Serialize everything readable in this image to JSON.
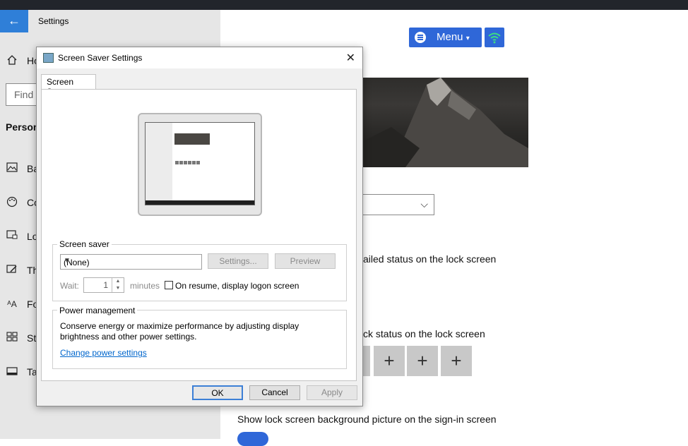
{
  "settings": {
    "title": "Settings",
    "back_icon": "←",
    "search_placeholder": "Find",
    "section_label": "Person",
    "nav_items": [
      {
        "label": "Ho",
        "icon": "home-icon"
      },
      {
        "label": "Ba",
        "icon": "picture-icon"
      },
      {
        "label": "Co",
        "icon": "palette-icon"
      },
      {
        "label": "Lo",
        "icon": "lock-screen-icon"
      },
      {
        "label": "Th",
        "icon": "brush-icon"
      },
      {
        "label": "Fo",
        "icon": "font-icon"
      },
      {
        "label": "St",
        "icon": "start-icon"
      },
      {
        "label": "Ta",
        "icon": "taskbar-icon"
      }
    ]
  },
  "toolbar": {
    "menu_label": "Menu",
    "menu_caret": "▾"
  },
  "content": {
    "detailed_status_text": "ailed status on the lock screen",
    "quick_status_text": "ck status on the lock screen",
    "show_background_text": "Show lock screen background picture on the sign-in screen",
    "plus_glyph": "+",
    "dropdown_chevron": "⌵"
  },
  "dialog": {
    "title": "Screen Saver Settings",
    "close_glyph": "✕",
    "tab_label": "Screen Saver",
    "screen_saver_group_label": "Screen saver",
    "screen_saver_value": "(None)",
    "settings_button": "Settings...",
    "preview_button": "Preview",
    "wait_label": "Wait:",
    "wait_value": "1",
    "minutes_label": "minutes",
    "resume_checkbox_label": "On resume, display logon screen",
    "resume_checked": false,
    "power_group_label": "Power management",
    "power_text": "Conserve energy or maximize performance by adjusting display brightness and other power settings.",
    "power_link": "Change power settings",
    "ok_button": "OK",
    "cancel_button": "Cancel",
    "apply_button": "Apply"
  },
  "colors": {
    "accent": "#2f67d8",
    "back_button": "#2f7fd8",
    "link": "#0066cc",
    "wifi_icon": "#3ddc84"
  }
}
